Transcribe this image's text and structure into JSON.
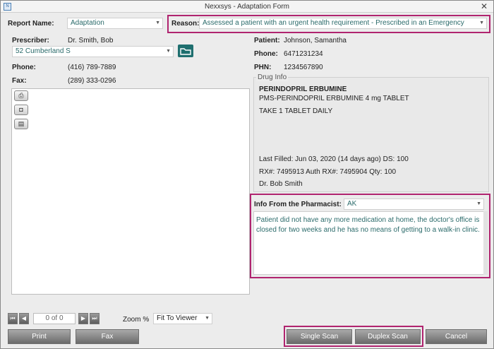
{
  "window": {
    "title": "Nexxsys - Adaptation Form",
    "app_icon_text": "N"
  },
  "report": {
    "label": "Report Name:",
    "value": "Adaptation"
  },
  "reason": {
    "label": "Reason:",
    "value": "Assessed a patient with an urgent health requirement - Prescribed in an Emergency"
  },
  "prescriber": {
    "label": "Prescriber:",
    "name": "Dr. Smith, Bob",
    "address": "52  Cumberland S",
    "phone_label": "Phone:",
    "phone": "(416) 789-7889",
    "fax_label": "Fax:",
    "fax": "(289) 333-0296"
  },
  "patient": {
    "label": "Patient:",
    "name": "Johnson, Samantha",
    "phone_label": "Phone:",
    "phone": "6471231234",
    "phn_label": "PHN:",
    "phn": "1234567890"
  },
  "drug": {
    "legend": "Drug Info",
    "name": "PERINDOPRIL ERBUMINE",
    "product": "PMS-PERINDOPRIL ERBUMINE 4 mg  TABLET",
    "directions": "TAKE 1 TABLET DAILY",
    "last_filled": "Last Filled:  Jun 03, 2020 (14 days ago)  DS:  100",
    "rx": "RX#:  7495913  Auth RX#:  7495904  Qty:  100",
    "doctor": "Dr. Bob Smith"
  },
  "pharmacist": {
    "label": "Info From the Pharmacist:",
    "value": "AK",
    "notes": "Patient did not have any more medication at home, the doctor's office is closed for two weeks and he has no means of getting to a walk-in clinic."
  },
  "viewer": {
    "page": "0 of 0",
    "zoom_label": "Zoom %",
    "zoom_value": "Fit To Viewer",
    "first_glyph": "⏮",
    "prev_glyph": "◀",
    "next_glyph": "▶",
    "last_glyph": "⏭"
  },
  "buttons": {
    "print": "Print",
    "fax": "Fax",
    "single_scan": "Single Scan",
    "duplex_scan": "Duplex Scan",
    "cancel": "Cancel"
  },
  "icons": {
    "printer": "printer-icon",
    "scanner": "mouse-icon",
    "document": "document-icon",
    "folder": "folder-icon"
  },
  "colors": {
    "highlight": "#b0246f",
    "teal_text": "#2b6b6b"
  }
}
